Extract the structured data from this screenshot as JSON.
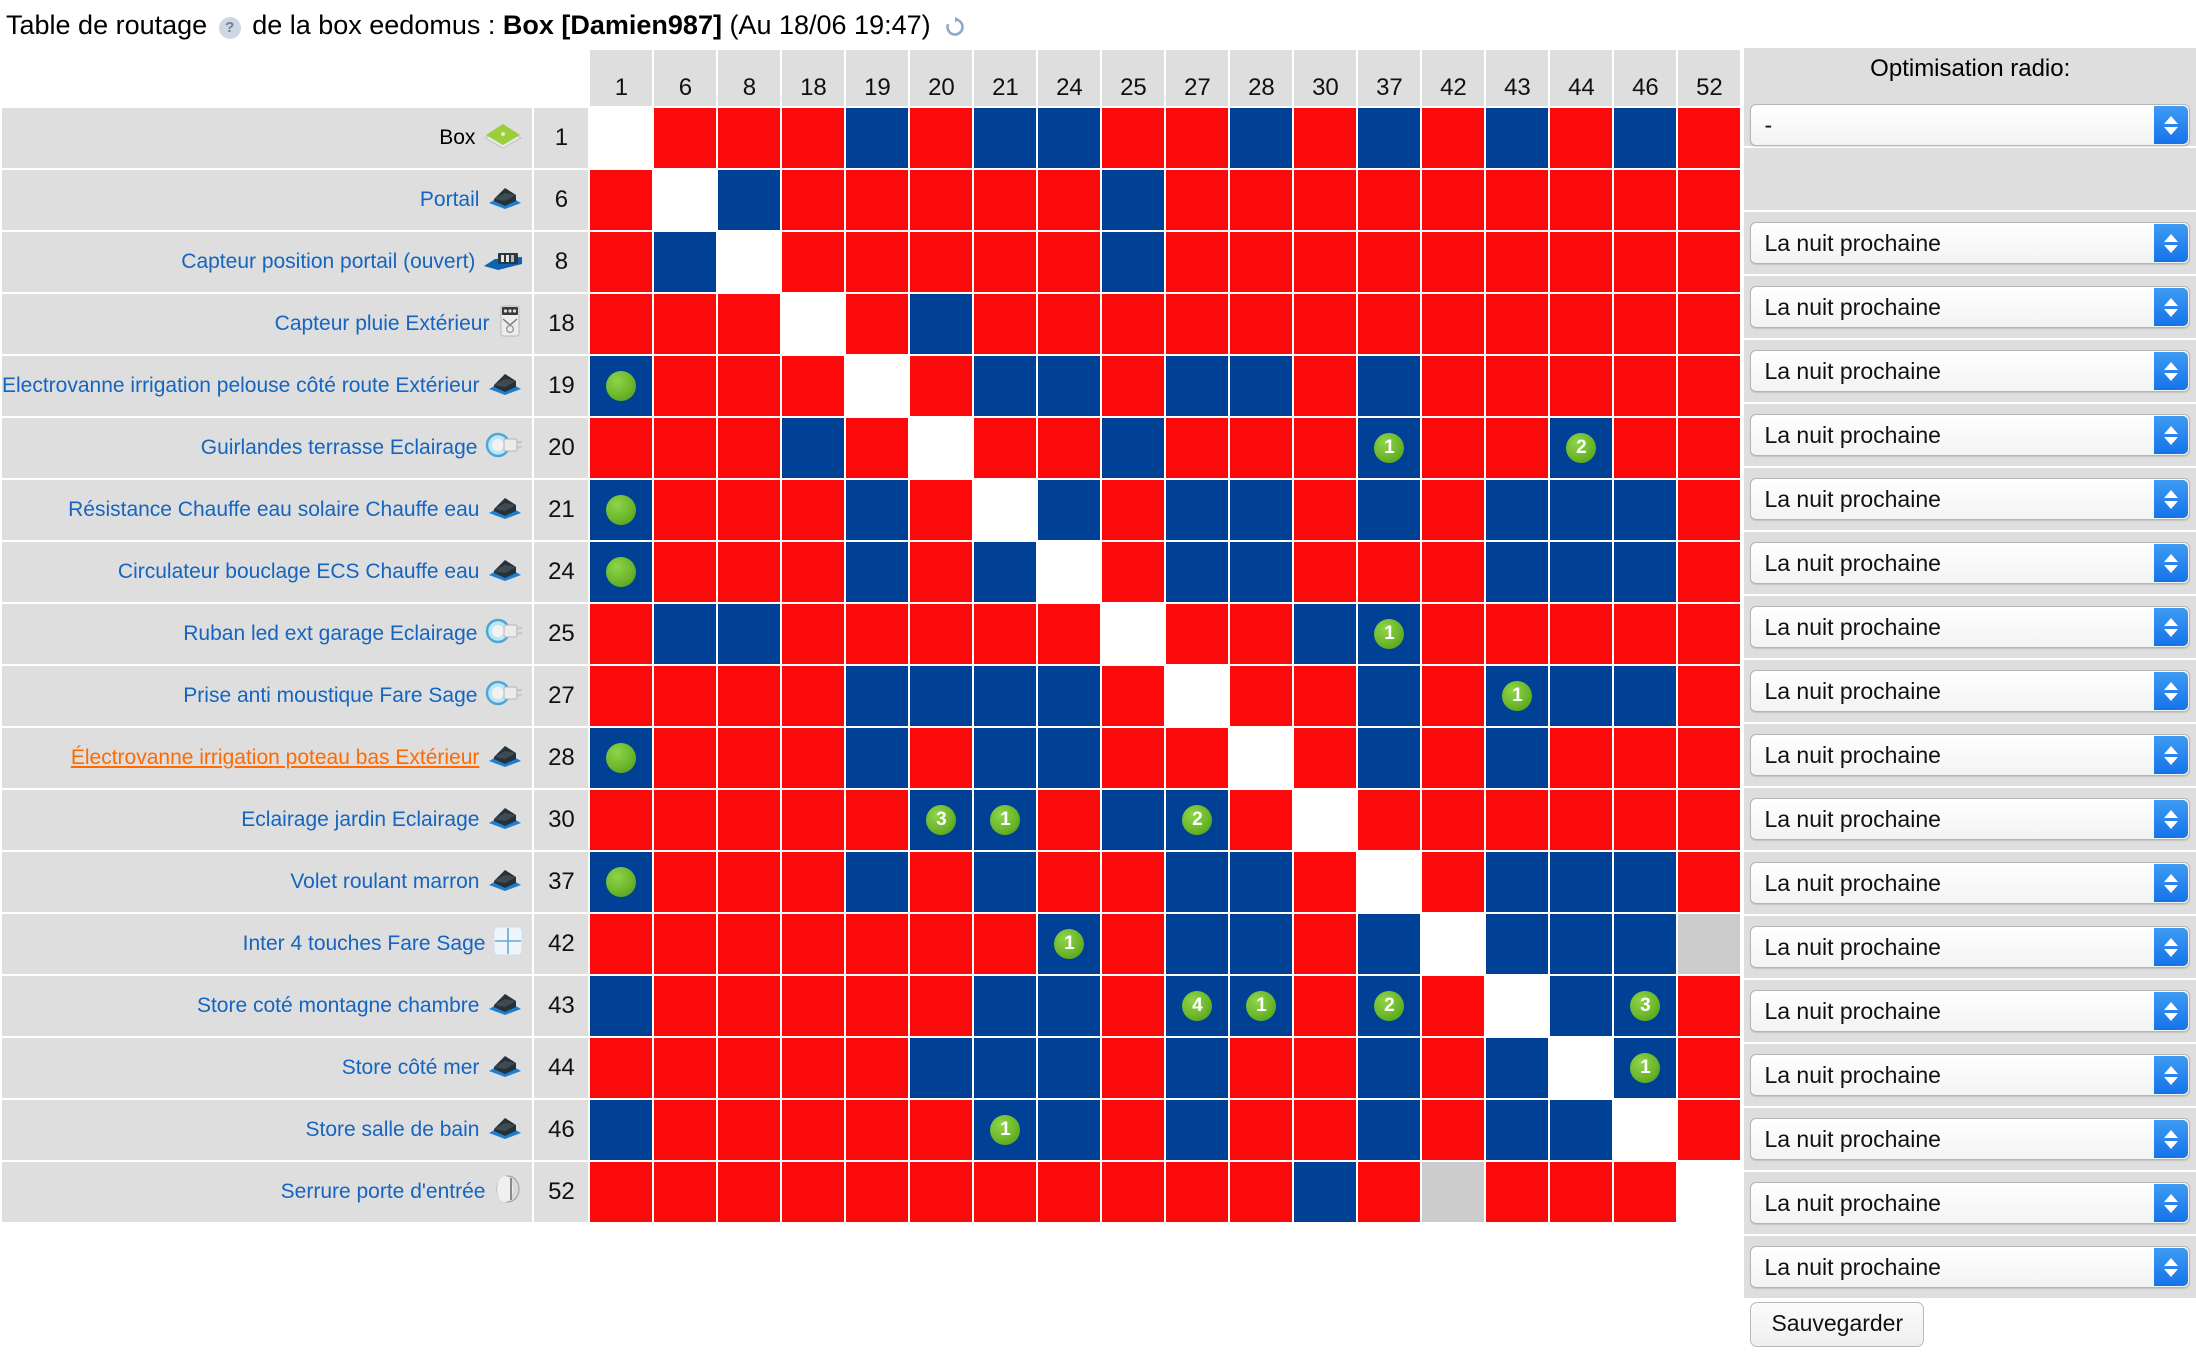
{
  "page": {
    "title_prefix": "Table de routage",
    "help_icon": "help-icon",
    "title_middle": "de la box eedomus :",
    "box_name": "Box [Damien987]",
    "timestamp": "(Au 18/06 19:47)",
    "refresh_icon": "refresh-icon"
  },
  "matrix": {
    "columns": [
      "1",
      "6",
      "8",
      "18",
      "19",
      "20",
      "21",
      "24",
      "25",
      "27",
      "28",
      "30",
      "37",
      "42",
      "43",
      "44",
      "46",
      "52"
    ],
    "rows": [
      {
        "label": "Box",
        "label_style": "plain",
        "icon": "box-eedomus-icon",
        "id": "1",
        "cells": [
          "w",
          "r",
          "r",
          "r",
          "b",
          "r",
          "b",
          "b",
          "r",
          "r",
          "b",
          "r",
          "b",
          "r",
          "b",
          "r",
          "b",
          "r"
        ],
        "badges": {},
        "select": null
      },
      {
        "label": "Portail",
        "label_style": "link",
        "icon": "actuator-module-icon",
        "id": "6",
        "cells": [
          "r",
          "w",
          "b",
          "r",
          "r",
          "r",
          "r",
          "r",
          "b",
          "r",
          "r",
          "r",
          "r",
          "r",
          "r",
          "r",
          "r",
          "r"
        ],
        "badges": {},
        "select": "La nuit prochaine"
      },
      {
        "label": "Capteur position portail (ouvert)",
        "label_style": "link",
        "icon": "door-sensor-icon",
        "id": "8",
        "cells": [
          "r",
          "b",
          "w",
          "r",
          "r",
          "r",
          "r",
          "r",
          "b",
          "r",
          "r",
          "r",
          "r",
          "r",
          "r",
          "r",
          "r",
          "r"
        ],
        "badges": {},
        "select": "La nuit prochaine"
      },
      {
        "label": "Capteur pluie Extérieur",
        "label_style": "link",
        "icon": "rain-sensor-icon",
        "id": "18",
        "cells": [
          "r",
          "r",
          "r",
          "w",
          "r",
          "b",
          "r",
          "r",
          "r",
          "r",
          "r",
          "r",
          "r",
          "r",
          "r",
          "r",
          "r",
          "r"
        ],
        "badges": {},
        "select": "La nuit prochaine"
      },
      {
        "label": "Electrovanne irrigation pelouse côté route Extérieur",
        "label_style": "link",
        "icon": "actuator-module-icon",
        "id": "19",
        "cells": [
          "b",
          "r",
          "r",
          "r",
          "w",
          "r",
          "b",
          "b",
          "r",
          "b",
          "b",
          "r",
          "b",
          "r",
          "r",
          "r",
          "r",
          "r"
        ],
        "badges": {
          "0": ""
        },
        "select": "La nuit prochaine"
      },
      {
        "label": "Guirlandes terrasse Eclairage",
        "label_style": "link",
        "icon": "smart-plug-icon",
        "id": "20",
        "cells": [
          "r",
          "r",
          "r",
          "b",
          "r",
          "w",
          "r",
          "r",
          "b",
          "r",
          "r",
          "r",
          "b",
          "r",
          "r",
          "b",
          "r",
          "r"
        ],
        "badges": {
          "12": "1",
          "15": "2"
        },
        "select": "La nuit prochaine"
      },
      {
        "label": "Résistance Chauffe eau solaire Chauffe eau",
        "label_style": "link",
        "icon": "actuator-module-icon",
        "id": "21",
        "cells": [
          "b",
          "r",
          "r",
          "r",
          "b",
          "r",
          "w",
          "b",
          "r",
          "b",
          "b",
          "r",
          "b",
          "r",
          "b",
          "b",
          "b",
          "r"
        ],
        "badges": {
          "0": ""
        },
        "select": "La nuit prochaine"
      },
      {
        "label": "Circulateur bouclage ECS Chauffe eau",
        "label_style": "link",
        "icon": "actuator-module-icon",
        "id": "24",
        "cells": [
          "b",
          "r",
          "r",
          "r",
          "b",
          "r",
          "b",
          "w",
          "r",
          "b",
          "b",
          "r",
          "r",
          "r",
          "b",
          "b",
          "b",
          "r"
        ],
        "badges": {
          "0": ""
        },
        "select": "La nuit prochaine"
      },
      {
        "label": "Ruban led ext garage Eclairage",
        "label_style": "link",
        "icon": "smart-plug-icon",
        "id": "25",
        "cells": [
          "r",
          "b",
          "b",
          "r",
          "r",
          "r",
          "r",
          "r",
          "w",
          "r",
          "r",
          "b",
          "b",
          "r",
          "r",
          "r",
          "r",
          "r"
        ],
        "badges": {
          "12": "1"
        },
        "select": "La nuit prochaine"
      },
      {
        "label": "Prise anti moustique Fare Sage",
        "label_style": "link",
        "icon": "smart-plug-icon",
        "id": "27",
        "cells": [
          "r",
          "r",
          "r",
          "r",
          "b",
          "b",
          "b",
          "b",
          "r",
          "w",
          "r",
          "r",
          "b",
          "r",
          "b",
          "b",
          "b",
          "r"
        ],
        "badges": {
          "14": "1"
        },
        "select": "La nuit prochaine"
      },
      {
        "label": "Électrovanne irrigation poteau bas Extérieur",
        "label_style": "active",
        "icon": "actuator-module-icon",
        "id": "28",
        "cells": [
          "b",
          "r",
          "r",
          "r",
          "b",
          "r",
          "b",
          "b",
          "r",
          "r",
          "w",
          "r",
          "b",
          "r",
          "b",
          "r",
          "r",
          "r"
        ],
        "badges": {
          "0": ""
        },
        "select": "La nuit prochaine"
      },
      {
        "label": "Eclairage jardin Eclairage",
        "label_style": "link",
        "icon": "actuator-module-icon",
        "id": "30",
        "cells": [
          "r",
          "r",
          "r",
          "r",
          "r",
          "b",
          "b",
          "r",
          "b",
          "b",
          "r",
          "w",
          "r",
          "r",
          "r",
          "r",
          "r",
          "r"
        ],
        "badges": {
          "5": "3",
          "6": "1",
          "9": "2"
        },
        "select": "La nuit prochaine"
      },
      {
        "label": "Volet roulant marron",
        "label_style": "link",
        "icon": "actuator-module-icon",
        "id": "37",
        "cells": [
          "b",
          "r",
          "r",
          "r",
          "b",
          "r",
          "b",
          "r",
          "r",
          "b",
          "b",
          "r",
          "w",
          "r",
          "b",
          "b",
          "b",
          "r"
        ],
        "badges": {
          "0": ""
        },
        "select": "La nuit prochaine"
      },
      {
        "label": "Inter 4 touches Fare Sage",
        "label_style": "link",
        "icon": "four-button-switch-icon",
        "id": "42",
        "cells": [
          "r",
          "r",
          "r",
          "r",
          "r",
          "r",
          "r",
          "b",
          "r",
          "b",
          "b",
          "r",
          "b",
          "w",
          "b",
          "b",
          "b",
          "g"
        ],
        "badges": {
          "7": "1"
        },
        "select": "La nuit prochaine"
      },
      {
        "label": "Store coté montagne chambre",
        "label_style": "link",
        "icon": "actuator-module-icon",
        "id": "43",
        "cells": [
          "b",
          "r",
          "r",
          "r",
          "r",
          "r",
          "b",
          "b",
          "r",
          "b",
          "b",
          "r",
          "b",
          "r",
          "w",
          "b",
          "b",
          "r"
        ],
        "badges": {
          "9": "4",
          "10": "1",
          "12": "2",
          "16": "3"
        },
        "select": "La nuit prochaine"
      },
      {
        "label": "Store côté mer",
        "label_style": "link",
        "icon": "actuator-module-icon",
        "id": "44",
        "cells": [
          "r",
          "r",
          "r",
          "r",
          "r",
          "b",
          "b",
          "b",
          "r",
          "b",
          "r",
          "r",
          "b",
          "r",
          "b",
          "w",
          "b",
          "r"
        ],
        "badges": {
          "16": "1"
        },
        "select": "La nuit prochaine"
      },
      {
        "label": "Store salle de bain",
        "label_style": "link",
        "icon": "actuator-module-icon",
        "id": "46",
        "cells": [
          "b",
          "r",
          "r",
          "r",
          "r",
          "r",
          "b",
          "b",
          "r",
          "b",
          "r",
          "r",
          "b",
          "r",
          "b",
          "b",
          "w",
          "r"
        ],
        "badges": {
          "6": "1"
        },
        "select": "La nuit prochaine"
      },
      {
        "label": "Serrure porte d'entrée",
        "label_style": "link",
        "icon": "door-lock-icon",
        "id": "52",
        "cells": [
          "r",
          "r",
          "r",
          "r",
          "r",
          "r",
          "r",
          "r",
          "r",
          "r",
          "r",
          "b",
          "r",
          "g",
          "r",
          "r",
          "r",
          "w"
        ],
        "badges": {},
        "select": "La nuit prochaine"
      }
    ]
  },
  "optimisation": {
    "header": "Optimisation radio:",
    "global_select_value": "-",
    "save_label": "Sauvegarder"
  },
  "colors": {
    "cell_red": "#fa0a0a",
    "cell_blue": "#004095",
    "cell_gray": "#cccccc",
    "badge_green": "#6cb72b",
    "link_blue": "#1565c0",
    "active_orange": "#ff6a00"
  }
}
